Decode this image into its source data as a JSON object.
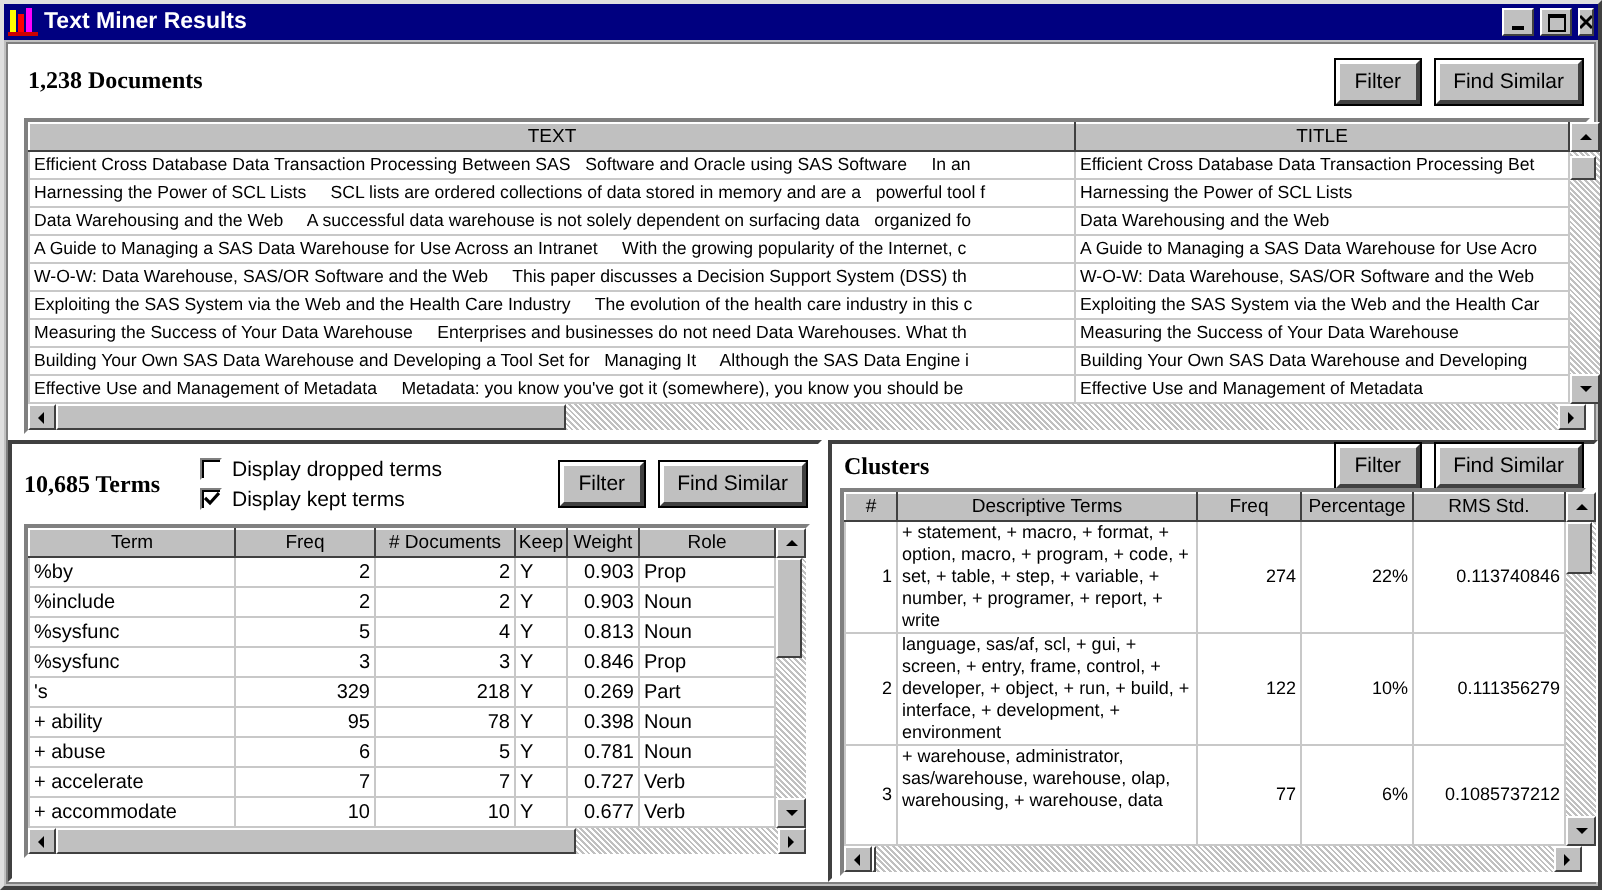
{
  "window": {
    "title": "Text Miner Results"
  },
  "documents": {
    "count_label": "1,238 Documents",
    "buttons": [
      "Filter",
      "Find Similar"
    ],
    "columns": [
      "TEXT",
      "TITLE"
    ],
    "rows": [
      {
        "text": "Efficient Cross Database Data Transaction Processing Between SAS   Software and Oracle using SAS Software     In an",
        "title": "Efficient Cross Database Data Transaction Processing Bet"
      },
      {
        "text": "Harnessing the Power of SCL Lists     SCL lists are ordered collections of data stored in memory and are a   powerful tool f",
        "title": "Harnessing the Power of SCL Lists"
      },
      {
        "text": "Data Warehousing and the Web     A successful data warehouse is not solely dependent on surfacing data   organized fo",
        "title": "Data Warehousing and the Web"
      },
      {
        "text": "A Guide to Managing a SAS Data Warehouse for Use Across an Intranet     With the growing popularity of the Internet, c",
        "title": "A Guide to Managing a SAS Data Warehouse for Use Acro"
      },
      {
        "text": "W-O-W: Data Warehouse, SAS/OR Software and the Web     This paper discusses a Decision Support System (DSS) th",
        "title": "W-O-W: Data Warehouse, SAS/OR Software and the Web"
      },
      {
        "text": "Exploiting the SAS System via the Web and the Health Care Industry     The evolution of the health care industry in this c",
        "title": "Exploiting the SAS System via the Web and the Health Car"
      },
      {
        "text": "Measuring the Success of Your Data Warehouse     Enterprises and businesses do not need Data Warehouses. What th",
        "title": "Measuring the Success of Your Data Warehouse"
      },
      {
        "text": "Building Your Own SAS Data Warehouse and Developing a Tool Set for   Managing It     Although the SAS Data Engine i",
        "title": "Building Your Own SAS Data Warehouse and Developing"
      },
      {
        "text": "Effective Use and Management of Metadata     Metadata: you know you've got it (somewhere), you know you should be",
        "title": "Effective Use and Management of Metadata"
      }
    ]
  },
  "terms": {
    "count_label": "10,685 Terms",
    "options": [
      {
        "label": "Display dropped terms",
        "checked": false
      },
      {
        "label": "Display kept terms",
        "checked": true
      }
    ],
    "buttons": [
      "Filter",
      "Find Similar"
    ],
    "columns": [
      "Term",
      "Freq",
      "# Documents",
      "Keep",
      "Weight",
      "Role"
    ],
    "rows": [
      [
        "%by",
        "2",
        "2",
        "Y",
        "0.903",
        "Prop"
      ],
      [
        "%include",
        "2",
        "2",
        "Y",
        "0.903",
        "Noun"
      ],
      [
        "%sysfunc",
        "5",
        "4",
        "Y",
        "0.813",
        "Noun"
      ],
      [
        "%sysfunc",
        "3",
        "3",
        "Y",
        "0.846",
        "Prop"
      ],
      [
        "'s",
        "329",
        "218",
        "Y",
        "0.269",
        "Part"
      ],
      [
        "+ ability",
        "95",
        "78",
        "Y",
        "0.398",
        "Noun"
      ],
      [
        "+ abuse",
        "6",
        "5",
        "Y",
        "0.781",
        "Noun"
      ],
      [
        "+ accelerate",
        "7",
        "7",
        "Y",
        "0.727",
        "Verb"
      ],
      [
        "+ accommodate",
        "10",
        "10",
        "Y",
        "0.677",
        "Verb"
      ]
    ]
  },
  "clusters": {
    "title": "Clusters",
    "buttons": [
      "Filter",
      "Find Similar"
    ],
    "columns": [
      "#",
      "Descriptive Terms",
      "Freq",
      "Percentage",
      "RMS Std."
    ],
    "rows": [
      [
        "1",
        "+ statement, + macro, + format, + option, macro, + program, + code, + set, + table, + step, + variable, + number, + programer, + report, + write",
        "274",
        "22%",
        "0.113740846"
      ],
      [
        "2",
        "language, sas/af, scl, + gui, + screen, + entry, frame, control, + developer, + object, + run, + build, + interface, + development, + environment",
        "122",
        "10%",
        "0.111356279"
      ],
      [
        "3",
        "+ warehouse, administrator, sas/warehouse, warehouse, olap, warehousing, + warehouse, data",
        "77",
        "6%",
        "0.1085737212"
      ]
    ]
  }
}
